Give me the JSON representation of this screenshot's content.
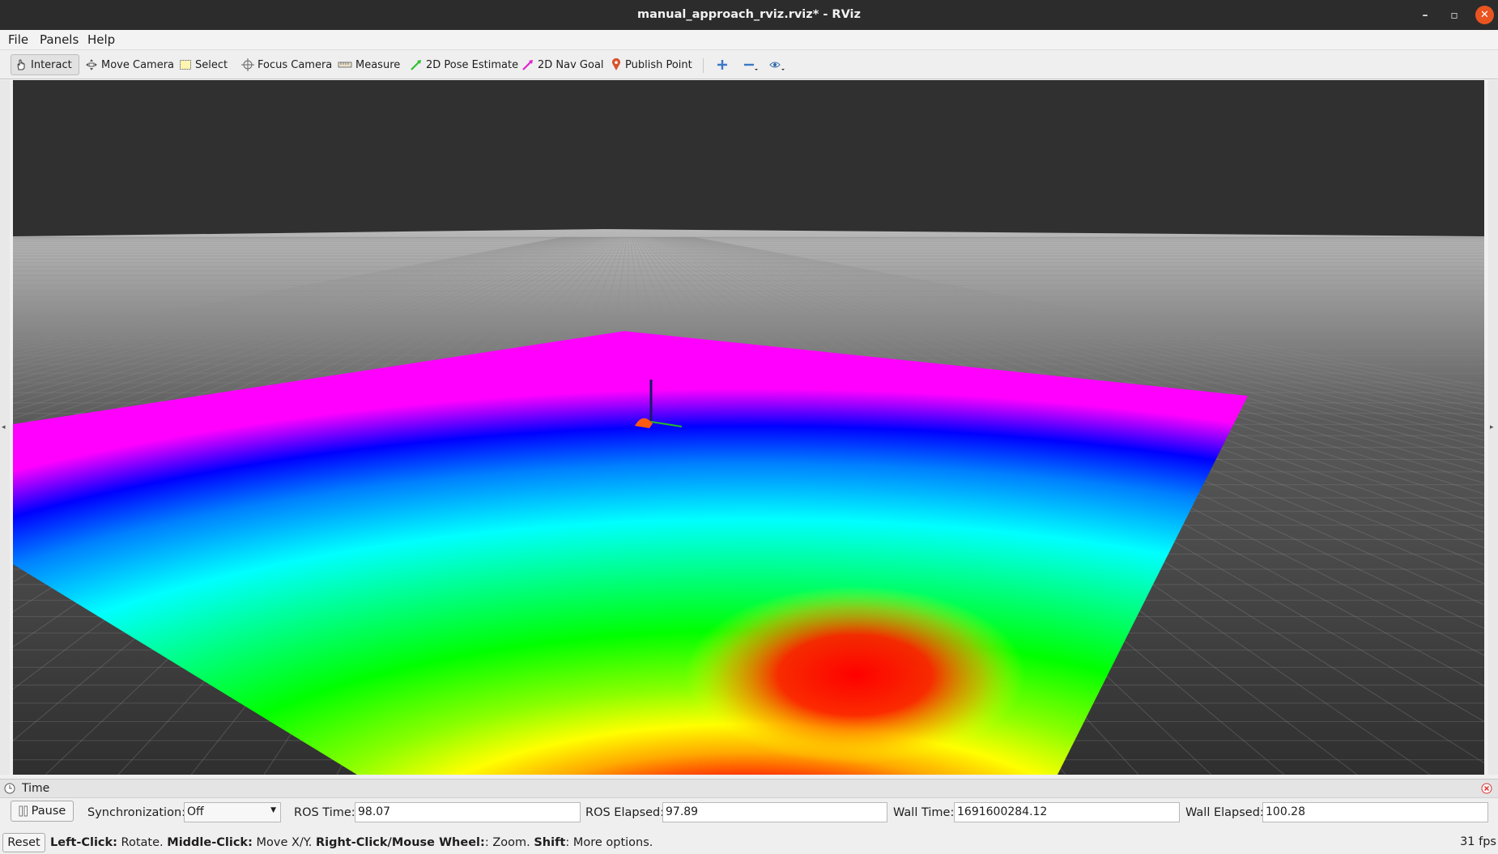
{
  "window": {
    "title": "manual_approach_rviz.rviz* - RViz"
  },
  "menu": {
    "file": "File",
    "panels": "Panels",
    "help": "Help"
  },
  "toolbar": {
    "interact": "Interact",
    "move_camera": "Move Camera",
    "select": "Select",
    "focus_camera": "Focus Camera",
    "measure": "Measure",
    "pose_estimate": "2D Pose Estimate",
    "nav_goal": "2D Nav Goal",
    "publish_point": "Publish Point"
  },
  "time_panel": {
    "title": "Time",
    "pause_label": "Pause",
    "sync_label": "Synchronization:",
    "sync_value": "Off",
    "ros_time_label": "ROS Time:",
    "ros_time": "98.07",
    "ros_elapsed_label": "ROS Elapsed:",
    "ros_elapsed": "97.89",
    "wall_time_label": "Wall Time:",
    "wall_time": "1691600284.12",
    "wall_elapsed_label": "Wall Elapsed:",
    "wall_elapsed": "100.28"
  },
  "status": {
    "reset_label": "Reset",
    "left_click": "Left-Click:",
    "left_click_action": " Rotate. ",
    "middle_click": "Middle-Click:",
    "middle_click_action": " Move X/Y. ",
    "right_click": "Right-Click/Mouse Wheel:",
    "right_click_action": ": Zoom. ",
    "shift": "Shift",
    "shift_action": ": More options.",
    "fps": "31 fps"
  },
  "colors": {
    "accent_close": "#e95420",
    "viewport_bg": "#303030",
    "costmap_gradient": [
      "#ff00ff",
      "#0000ff",
      "#00ffff",
      "#00ff00",
      "#ffff00",
      "#ff0000"
    ]
  }
}
